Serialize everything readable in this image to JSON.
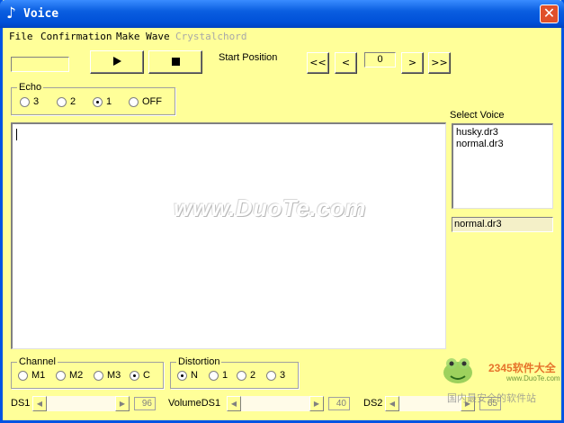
{
  "window": {
    "title": "Voice",
    "title_icon": "music-note-icon"
  },
  "menu": [
    {
      "label": "File",
      "enabled": true
    },
    {
      "label": "Confirmation",
      "enabled": true
    },
    {
      "label": "Make Wave",
      "enabled": true
    },
    {
      "label": "Crystalchord",
      "enabled": false
    }
  ],
  "toolbar": {
    "status_value": "",
    "play_icon": "play-icon",
    "stop_icon": "stop-icon",
    "start_position_label": "Start Position",
    "nav": {
      "first": "<<",
      "prev": "<",
      "next": ">",
      "last": ">>"
    },
    "position_value": "0"
  },
  "echo": {
    "label": "Echo",
    "options": [
      "3",
      "2",
      "1",
      "OFF"
    ],
    "selected": "1"
  },
  "editor": {
    "text": ""
  },
  "voice": {
    "label": "Select Voice",
    "items": [
      "husky.dr3",
      "normal.dr3"
    ],
    "selected_value": "normal.dr3"
  },
  "channel": {
    "label": "Channel",
    "options": [
      "M1",
      "M2",
      "M3",
      "C"
    ],
    "selected": "C"
  },
  "distortion": {
    "label": "Distortion",
    "options": [
      "N",
      "1",
      "2",
      "3"
    ],
    "selected": "N"
  },
  "sliders": {
    "ds1": {
      "label": "DS1",
      "value": "96"
    },
    "volume_ds1": {
      "label": "VolumeDS1",
      "value": "40"
    },
    "ds2": {
      "label": "DS2",
      "value": "65"
    }
  },
  "watermark": "www.DuoTe.com",
  "logo": {
    "brand": "2345软件大全",
    "url": "www.DuoTe.com",
    "tagline": "国内最安全的软件站"
  },
  "colors": {
    "background": "#ffff99",
    "titlebar": "#0a5ee0"
  }
}
